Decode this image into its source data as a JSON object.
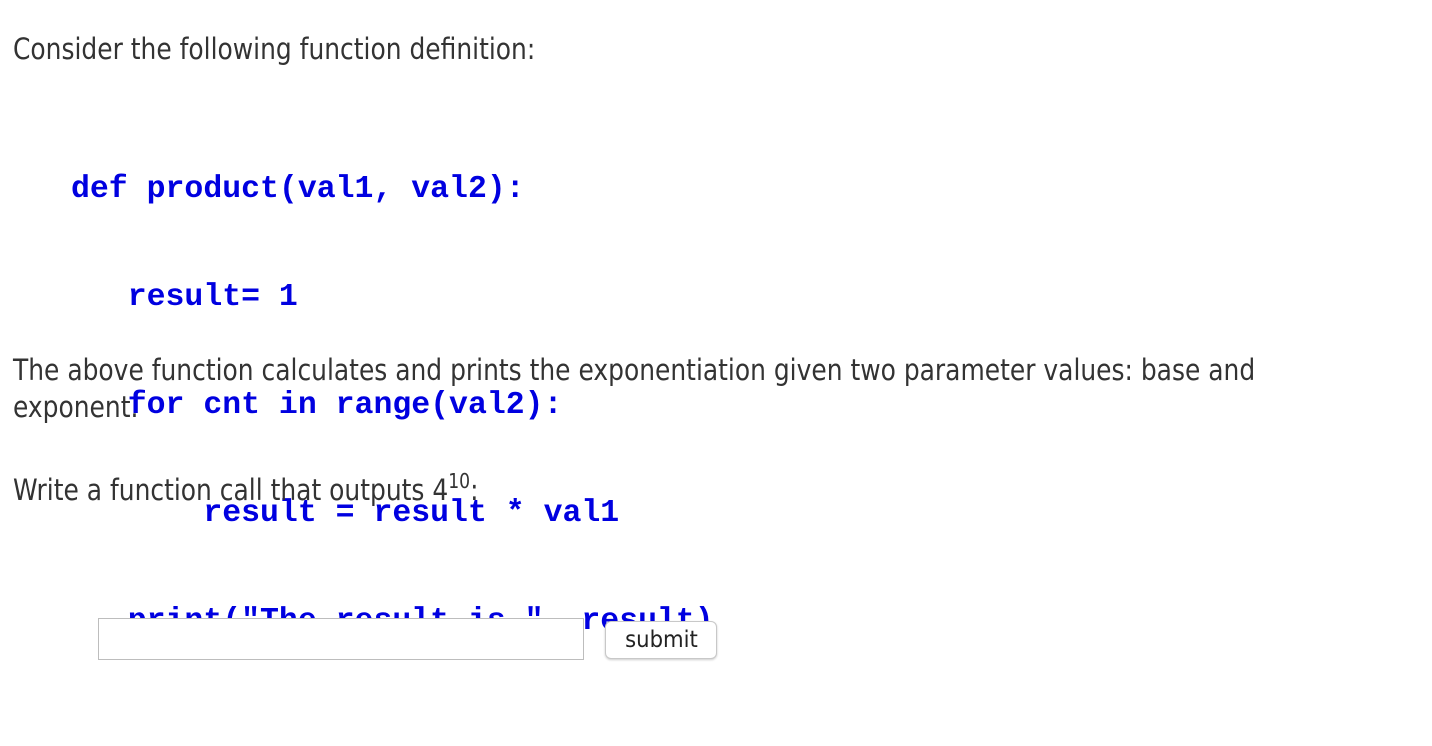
{
  "intro": "Consider the following function definition:",
  "code_lines": [
    "def product(val1, val2):",
    "   result= 1",
    "   for cnt in range(val2):",
    "       result = result * val1",
    "   print(\"The result is \", result)"
  ],
  "description_line1": "The above function calculates and prints the exponentiation given two parameter values: base and",
  "description_line2": "exponent.",
  "prompt": {
    "prefix": "Write a function call that outputs 4",
    "exponent": "10",
    "suffix": ":"
  },
  "answer": {
    "value": "",
    "placeholder": ""
  },
  "submit_label": "submit",
  "colors": {
    "code": "#0000e0",
    "text": "#333333"
  }
}
